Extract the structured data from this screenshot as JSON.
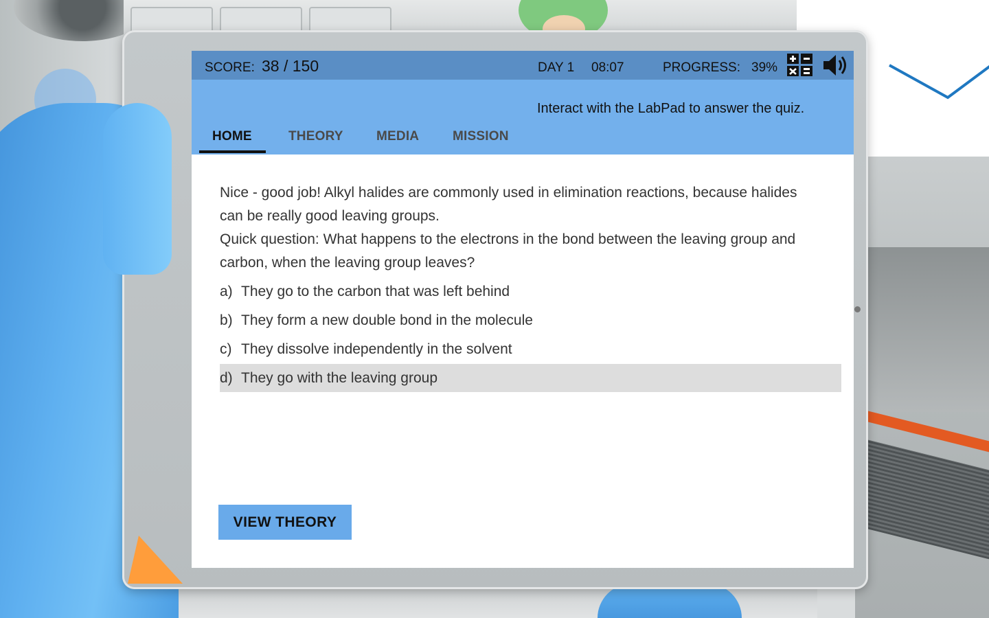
{
  "status": {
    "score_label": "SCORE:",
    "score_value": "38 / 150",
    "day": "DAY 1",
    "time": "08:07",
    "progress_label": "PROGRESS:",
    "progress_value": "39%",
    "icons": [
      "calculator-icon",
      "sound-icon"
    ]
  },
  "nav": {
    "tabs": [
      {
        "label": "HOME",
        "active": true
      },
      {
        "label": "THEORY",
        "active": false
      },
      {
        "label": "MEDIA",
        "active": false
      },
      {
        "label": "MISSION",
        "active": false
      }
    ],
    "instruction": "Interact with the LabPad to answer the quiz."
  },
  "quiz": {
    "feedback": "Nice - good job! Alkyl halides are commonly used in elimination reactions, because halides can be really good leaving groups.",
    "question": "Quick question: What happens to the electrons in the bond between the leaving group and carbon, when the leaving group leaves?",
    "options": [
      {
        "letter": "a)",
        "text": "They go to the carbon that was left behind"
      },
      {
        "letter": "b)",
        "text": "They form a new double bond in the molecule"
      },
      {
        "letter": "c)",
        "text": "They dissolve independently in the solvent"
      },
      {
        "letter": "d)",
        "text": "They go with the leaving group",
        "selected": true
      }
    ]
  },
  "actions": {
    "view_theory_label": "VIEW THEORY"
  },
  "colors": {
    "status_bar": "#5a8ec5",
    "nav_header": "#73b0ec",
    "button": "#69aaea",
    "selected_option": "#dddddd",
    "glove": "#5fb0f0"
  }
}
